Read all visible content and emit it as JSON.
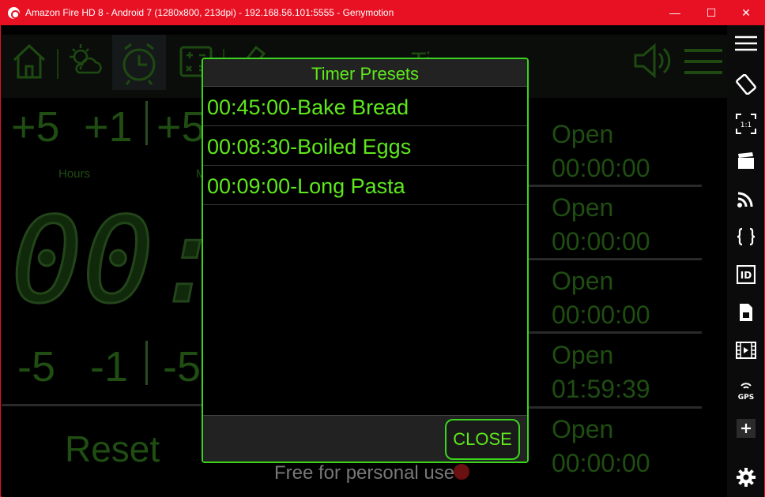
{
  "window": {
    "title": "Amazon Fire HD 8 - Android 7 (1280x800, 213dpi) - 192.168.56.101:5555 - Genymotion",
    "controls": {
      "minimize": "—",
      "maximize": "☐",
      "close": "✕"
    }
  },
  "app": {
    "topbar": {
      "icons": [
        "home-icon",
        "weather-icon",
        "alarm-clock-icon",
        "calculator-icon",
        "ruler-icon",
        "volume-icon",
        "menu-icon"
      ],
      "partial_title": "Ti"
    },
    "adjust_top": [
      "+5",
      "+1",
      "+5"
    ],
    "adjust_bottom": [
      "-5",
      "-1",
      "-5"
    ],
    "unit_labels": {
      "hours": "Hours",
      "minutes_partial": "M"
    },
    "display_partial": "00:0",
    "reset_label": "Reset",
    "watermark": "Free for personal use",
    "timer_slots": [
      {
        "label": "Open",
        "time": "00:00:00"
      },
      {
        "label": "Open",
        "time": "00:00:00"
      },
      {
        "label": "Open",
        "time": "00:00:00"
      },
      {
        "label": "Open",
        "time": "01:59:39"
      },
      {
        "label": "Open",
        "time": "00:00:00"
      }
    ]
  },
  "dialog": {
    "title": "Timer Presets",
    "presets": [
      "00:45:00-Bake Bread",
      "00:08:30-Boiled Eggs",
      "00:09:00-Long Pasta"
    ],
    "close_label": "CLOSE"
  },
  "sidebar": {
    "items": [
      {
        "icon": "hamburger-menu-icon"
      },
      {
        "icon": "rotate-icon"
      },
      {
        "icon": "pixel-perfect-icon",
        "label": "1:1"
      },
      {
        "icon": "clapperboard-icon"
      },
      {
        "icon": "cast-icon"
      },
      {
        "icon": "braces-icon",
        "label": "{ }"
      },
      {
        "icon": "id-icon",
        "label": "ID"
      },
      {
        "icon": "sim-card-icon"
      },
      {
        "icon": "film-icon"
      },
      {
        "icon": "gps-icon",
        "label": "GPS"
      },
      {
        "icon": "plus-icon",
        "label": "+"
      },
      {
        "icon": "gear-icon"
      }
    ]
  },
  "colors": {
    "accent": "#5ee81c",
    "titlebar": "#e81123",
    "dim_green": "#1f4d12"
  }
}
